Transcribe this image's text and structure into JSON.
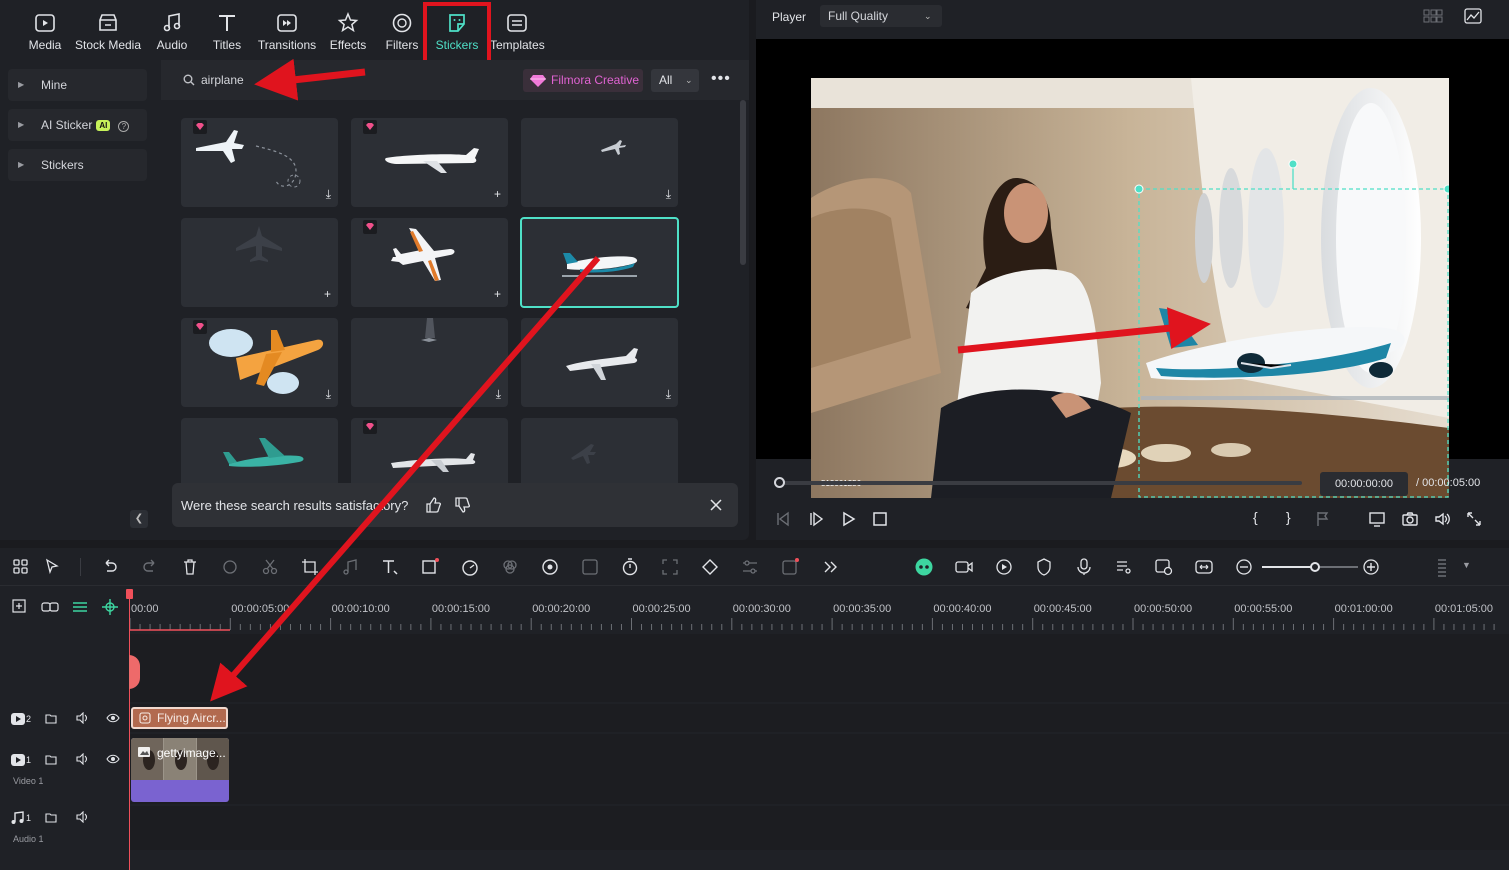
{
  "tabs": [
    {
      "label": "Media",
      "icon": "media-icon"
    },
    {
      "label": "Stock Media",
      "icon": "stock-media-icon"
    },
    {
      "label": "Audio",
      "icon": "audio-note-icon"
    },
    {
      "label": "Titles",
      "icon": "titles-t-icon"
    },
    {
      "label": "Transitions",
      "icon": "transitions-icon"
    },
    {
      "label": "Effects",
      "icon": "effects-star-icon"
    },
    {
      "label": "Filters",
      "icon": "filters-icon"
    },
    {
      "label": "Stickers",
      "icon": "stickers-icon",
      "active": true
    },
    {
      "label": "Templates",
      "icon": "templates-icon"
    }
  ],
  "sidebar": {
    "items": [
      {
        "label": "Mine"
      },
      {
        "label": "AI Sticker",
        "badge": "AI"
      },
      {
        "label": "Stickers"
      }
    ]
  },
  "search": {
    "value": "airplane",
    "filter_chip": "Filmora Creative",
    "category": "All"
  },
  "feedback": {
    "question": "Were these search results satisfactory?"
  },
  "player": {
    "title": "Player",
    "quality": "Full Quality",
    "current_time": "00:00:00:00",
    "total_time": "/ 00:00:05:00",
    "watermark": "513061256"
  },
  "timeline": {
    "ruler_labels": [
      "00:00",
      "00:00:05:00",
      "00:00:10:00",
      "00:00:15:00",
      "00:00:20:00",
      "00:00:25:00",
      "00:00:30:00",
      "00:00:35:00",
      "00:00:40:00",
      "00:00:45:00",
      "00:00:50:00",
      "00:00:55:00",
      "00:01:00:00",
      "00:01:05:00"
    ],
    "tracks": [
      {
        "number": "2",
        "label": ""
      },
      {
        "number": "1",
        "label": "Video 1"
      },
      {
        "number": "1",
        "label": "Audio 1"
      }
    ],
    "clips": {
      "sticker": "Flying Aircr...",
      "video": "gettyimage..."
    },
    "zoom_level": 0.55
  },
  "colors": {
    "accent": "#4fe0c7",
    "annotation_red": "#e0141e",
    "sticker_clip": "#b26a4f",
    "video_clip": "#7a63d0",
    "playhead": "#f0505a",
    "premium": "#e063d2"
  }
}
